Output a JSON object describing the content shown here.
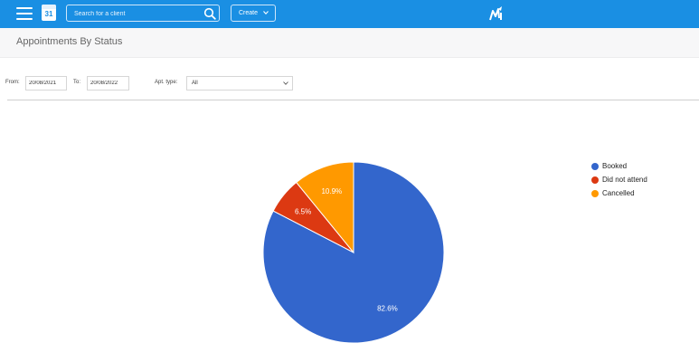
{
  "topbar": {
    "calendar_day": "31",
    "search_placeholder": "Search for a client",
    "create_label": "Create",
    "bg_color": "#1a8fe3"
  },
  "page": {
    "title": "Appointments By Status"
  },
  "filters": {
    "from_label": "From:",
    "from_value": "20/08/2021",
    "to_label": "To:",
    "to_value": "20/08/2022",
    "apt_type_label": "Apt. type:",
    "apt_type_value": "All"
  },
  "chart_data": {
    "type": "pie",
    "categories": [
      "Booked",
      "Did not attend",
      "Cancelled"
    ],
    "values": [
      82.6,
      6.5,
      10.9
    ],
    "labels": [
      "82.6%",
      "6.5%",
      "10.9%"
    ],
    "colors": [
      "#3366cc",
      "#dc3912",
      "#ff9900"
    ],
    "legend_position": "right"
  },
  "legend": {
    "items": [
      {
        "label": "Booked",
        "color": "#3366cc"
      },
      {
        "label": "Did not attend",
        "color": "#dc3912"
      },
      {
        "label": "Cancelled",
        "color": "#ff9900"
      }
    ]
  }
}
